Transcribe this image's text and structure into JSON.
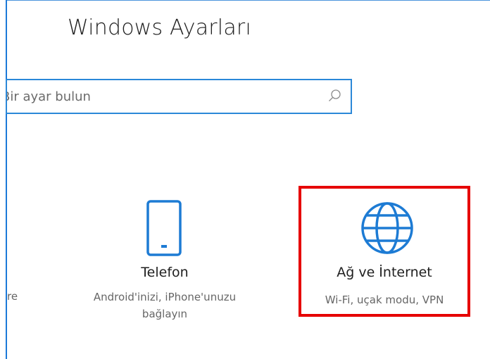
{
  "window": {
    "title": "Windows Ayarları"
  },
  "search": {
    "placeholder": "Bir ayar bulun"
  },
  "colors": {
    "accent": "#2b88d8",
    "highlight": "#e60000",
    "text": "#1f1f1f",
    "muted_text": "#666666"
  },
  "tiles": [
    {
      "label": "Telefon",
      "description": "Android'inizi, iPhone'unuzu bağlayın",
      "icon": "phone-icon"
    },
    {
      "label": "Ağ ve İnternet",
      "description": "Wi-Fi, uçak modu, VPN",
      "icon": "globe-icon"
    }
  ],
  "partial_tile_text": "re"
}
